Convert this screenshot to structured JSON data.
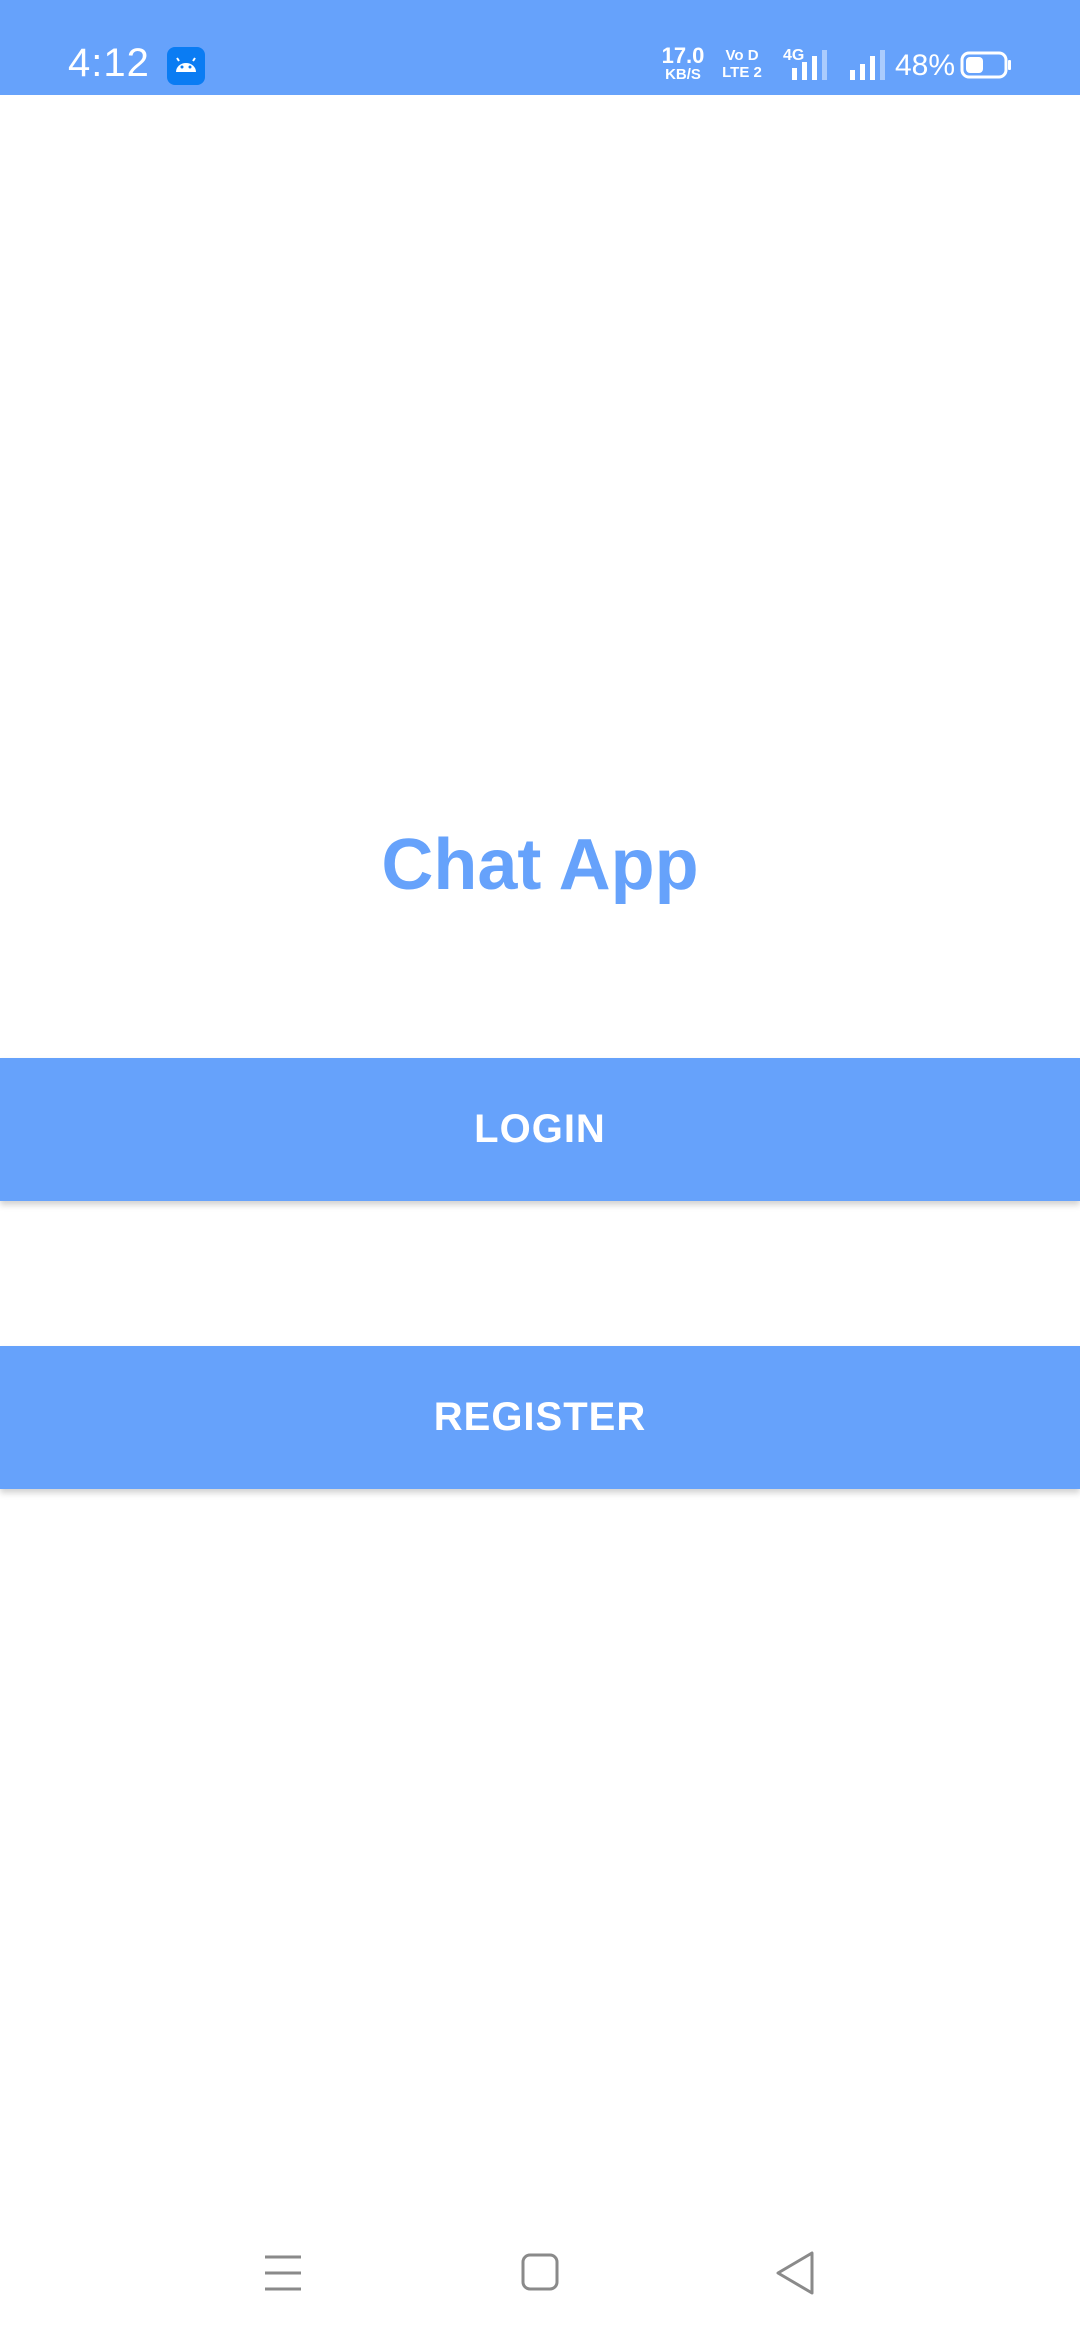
{
  "status_bar": {
    "time": "4:12",
    "net_speed_value": "17.0",
    "net_speed_unit": "KB/S",
    "volte_line1": "Vo D",
    "volte_line2": "LTE 2",
    "net_type": "4G",
    "battery_percent": "48%",
    "battery_level": 0.48,
    "background_color": "#66a2fb",
    "icons": [
      "android-app-icon",
      "signal-icon",
      "signal-icon",
      "battery-icon"
    ]
  },
  "main": {
    "title": "Chat App",
    "title_color": "#66a2fb",
    "login_label": "LOGIN",
    "register_label": "REGISTER",
    "button_color": "#66a2fb"
  },
  "nav_bar": {
    "icons": [
      "menu-icon",
      "home-icon",
      "back-icon"
    ]
  }
}
